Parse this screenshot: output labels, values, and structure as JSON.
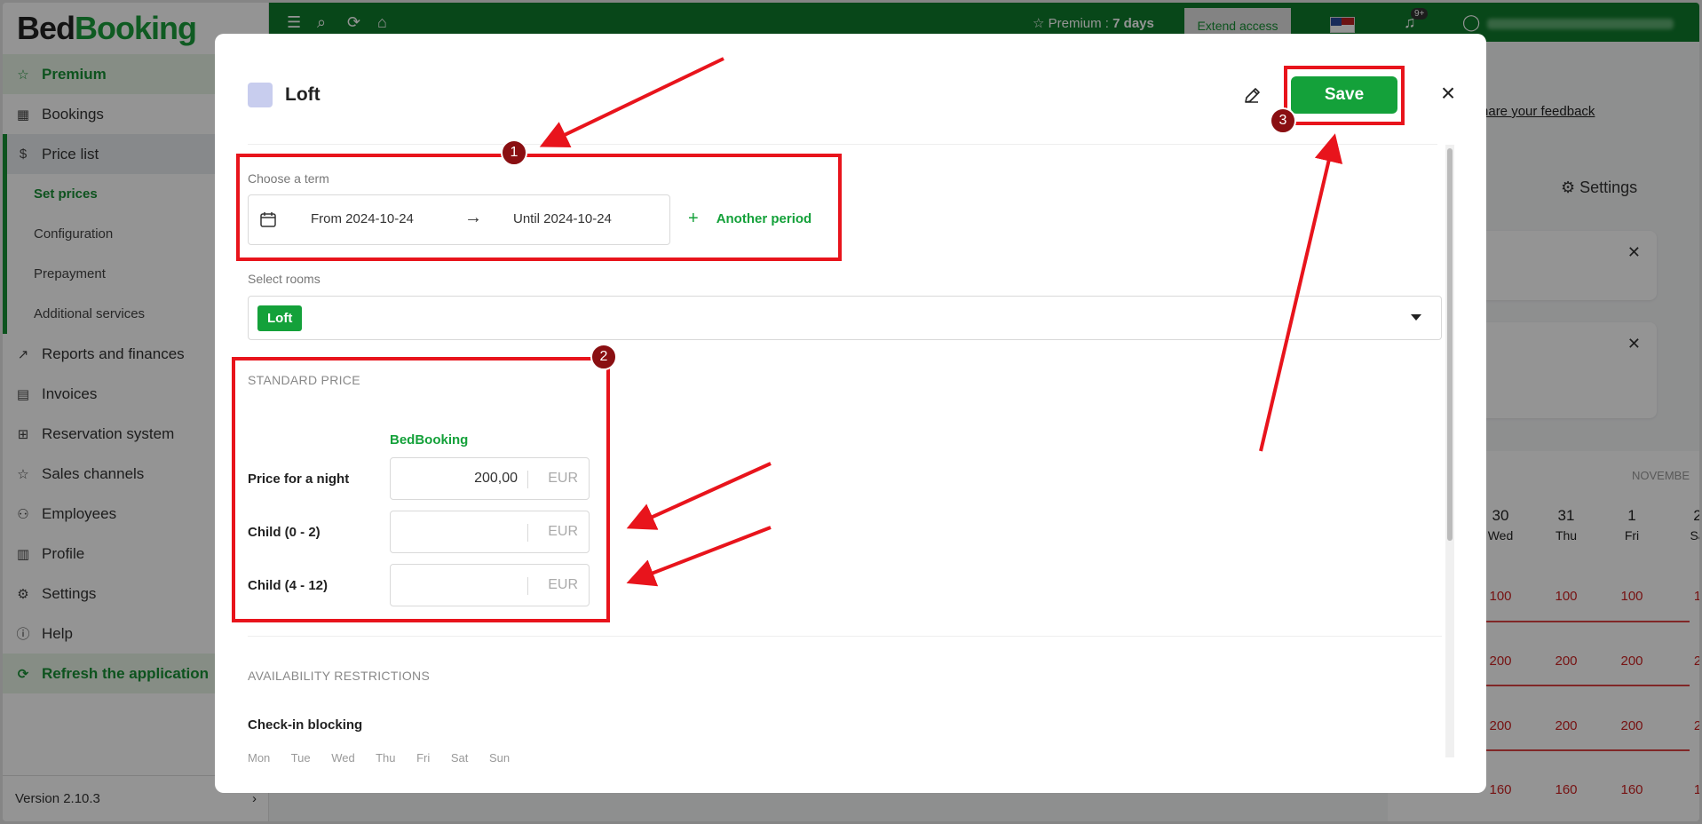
{
  "app": {
    "logo_part1": "Bed",
    "logo_part2": "Booking",
    "version": "Version 2.10.3",
    "sidebar": {
      "items": [
        {
          "label": "Premium",
          "icon": "star-icon"
        },
        {
          "label": "Bookings",
          "icon": "calendar-icon"
        },
        {
          "label": "Price list",
          "icon": "dollar-icon"
        },
        {
          "label": "Set prices"
        },
        {
          "label": "Configuration"
        },
        {
          "label": "Prepayment"
        },
        {
          "label": "Additional services"
        },
        {
          "label": "Reports and finances",
          "icon": "chart-icon"
        },
        {
          "label": "Invoices",
          "icon": "invoice-icon"
        },
        {
          "label": "Reservation system",
          "icon": "grid-icon"
        },
        {
          "label": "Sales channels",
          "icon": "star-outline-icon"
        },
        {
          "label": "Employees",
          "icon": "user-plus-icon"
        },
        {
          "label": "Profile",
          "icon": "building-icon"
        },
        {
          "label": "Settings",
          "icon": "gear-icon"
        },
        {
          "label": "Help",
          "icon": "info-icon"
        },
        {
          "label": "Refresh the application",
          "icon": "refresh-icon"
        }
      ]
    },
    "topbar": {
      "premium_label": "Premium : ",
      "premium_days": "7 days",
      "extend_label": "Extend access",
      "notifications_badge": "9+"
    },
    "feedback_link": "Share your feedback",
    "settings_label": "Settings",
    "calendar": {
      "month": "NOVEMBE",
      "days": [
        {
          "num": "30",
          "dow": "Wed"
        },
        {
          "num": "31",
          "dow": "Thu"
        },
        {
          "num": "1",
          "dow": "Fri"
        },
        {
          "num": "2",
          "dow": "Sa"
        }
      ],
      "rows": [
        [
          "100",
          "100",
          "100",
          "1"
        ],
        [
          "200",
          "200",
          "200",
          "2"
        ],
        [
          "200",
          "200",
          "200",
          "2"
        ],
        [
          "160",
          "160",
          "160",
          "1"
        ]
      ]
    }
  },
  "modal": {
    "title": "Loft",
    "save_label": "Save",
    "term": {
      "label": "Choose a term",
      "from": "From 2024-10-24",
      "until": "Until 2024-10-24",
      "another_period": "Another period"
    },
    "rooms": {
      "label": "Select rooms",
      "selected": "Loft"
    },
    "standard_price": {
      "heading": "STANDARD PRICE",
      "channel": "BedBooking",
      "rows": [
        {
          "label": "Price for a night",
          "value": "200,00",
          "currency": "EUR"
        },
        {
          "label": "Child (0 - 2)",
          "value": "",
          "currency": "EUR"
        },
        {
          "label": "Child (4 - 12)",
          "value": "",
          "currency": "EUR"
        }
      ]
    },
    "availability": {
      "heading": "AVAILABILITY RESTRICTIONS",
      "checkin_label": "Check-in blocking",
      "days": "Mon Tue Wed Thu Fri Sat Sun"
    }
  },
  "annotations": {
    "color": "#e8141c",
    "badge_color": "#8a0f12",
    "numbers": [
      "1",
      "2",
      "3"
    ]
  }
}
